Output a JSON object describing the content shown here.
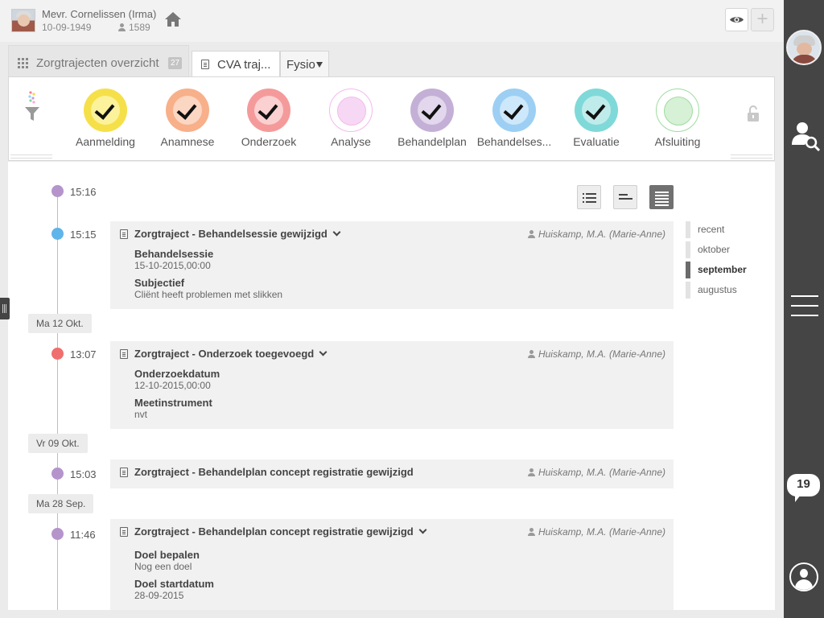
{
  "header": {
    "patient_name": "Mevr. Cornelissen (Irma)",
    "birth_date": "10-09-1949",
    "patient_number": "1589",
    "icons": [
      "patient-photo",
      "home-icon",
      "eye-icon",
      "plus-icon"
    ]
  },
  "tabs": {
    "overview_label": "Zorgtrajecten overzicht",
    "overview_count": "27",
    "cva_label": "CVA traj...",
    "fysio_label": "Fysio"
  },
  "phases": [
    {
      "label": "Aanmelding",
      "color": "#f5e04a",
      "inner": "#fbf29b",
      "done": true
    },
    {
      "label": "Anamnese",
      "color": "#f7b08a",
      "inner": "#fbd6c2",
      "done": true
    },
    {
      "label": "Onderzoek",
      "color": "#f59a9a",
      "inner": "#fbd0d0",
      "done": true
    },
    {
      "label": "Analyse",
      "color": "#f3b9ef",
      "inner": "#f7d8f4",
      "done": false
    },
    {
      "label": "Behandelplan",
      "color": "#c4b0d6",
      "inner": "#e2d7ec",
      "done": true
    },
    {
      "label": "Behandelses...",
      "color": "#9ccff3",
      "inner": "#cde8fa",
      "done": true
    },
    {
      "label": "Evaluatie",
      "color": "#7fd9d8",
      "inner": "#bfeceb",
      "done": true
    },
    {
      "label": "Afsluiting",
      "color": "#9fdc9f",
      "inner": "#d6f1d6",
      "done": false
    }
  ],
  "timeline": {
    "times": [
      "15:16",
      "15:15",
      "13:07",
      "15:03",
      "11:46"
    ],
    "dot_colors": [
      "#b594cc",
      "#5fb4ea",
      "#ef6f6f",
      "#b594cc",
      "#b594cc"
    ],
    "date_chips": [
      "Ma 12 Okt.",
      "Vr 09 Okt.",
      "Ma 28 Sep."
    ],
    "entries": [
      {
        "title": "Zorgtraject - Behandelsessie gewijzigd",
        "author": "Huiskamp, M.A. (Marie-Anne)",
        "fields": [
          {
            "label": "Behandelsessie",
            "value": "15-10-2015,00:00"
          },
          {
            "label": "Subjectief",
            "value": "Cliënt heeft problemen met slikken"
          }
        ]
      },
      {
        "title": "Zorgtraject - Onderzoek toegevoegd",
        "author": "Huiskamp, M.A. (Marie-Anne)",
        "fields": [
          {
            "label": "Onderzoekdatum",
            "value": "12-10-2015,00:00"
          },
          {
            "label": "Meetinstrument",
            "value": "nvt"
          }
        ]
      },
      {
        "title": "Zorgtraject - Behandelplan concept registratie gewijzigd",
        "author": "Huiskamp, M.A. (Marie-Anne)",
        "fields": []
      },
      {
        "title": "Zorgtraject - Behandelplan concept registratie gewijzigd",
        "author": "Huiskamp, M.A. (Marie-Anne)",
        "fields": [
          {
            "label": "Doel bepalen",
            "value": "Nog een doel"
          },
          {
            "label": "Doel startdatum",
            "value": "28-09-2015"
          }
        ]
      }
    ]
  },
  "month_nav": {
    "items": [
      "recent",
      "oktober",
      "september",
      "augustus"
    ],
    "active": "september"
  },
  "view_buttons": [
    "list-view-icon",
    "compact-view-icon",
    "detail-view-icon"
  ],
  "rightbar": {
    "notification_count": "19",
    "icons": [
      "user-avatar",
      "search-user-icon",
      "hamburger-menu-icon",
      "chat-icon",
      "profile-icon"
    ]
  }
}
